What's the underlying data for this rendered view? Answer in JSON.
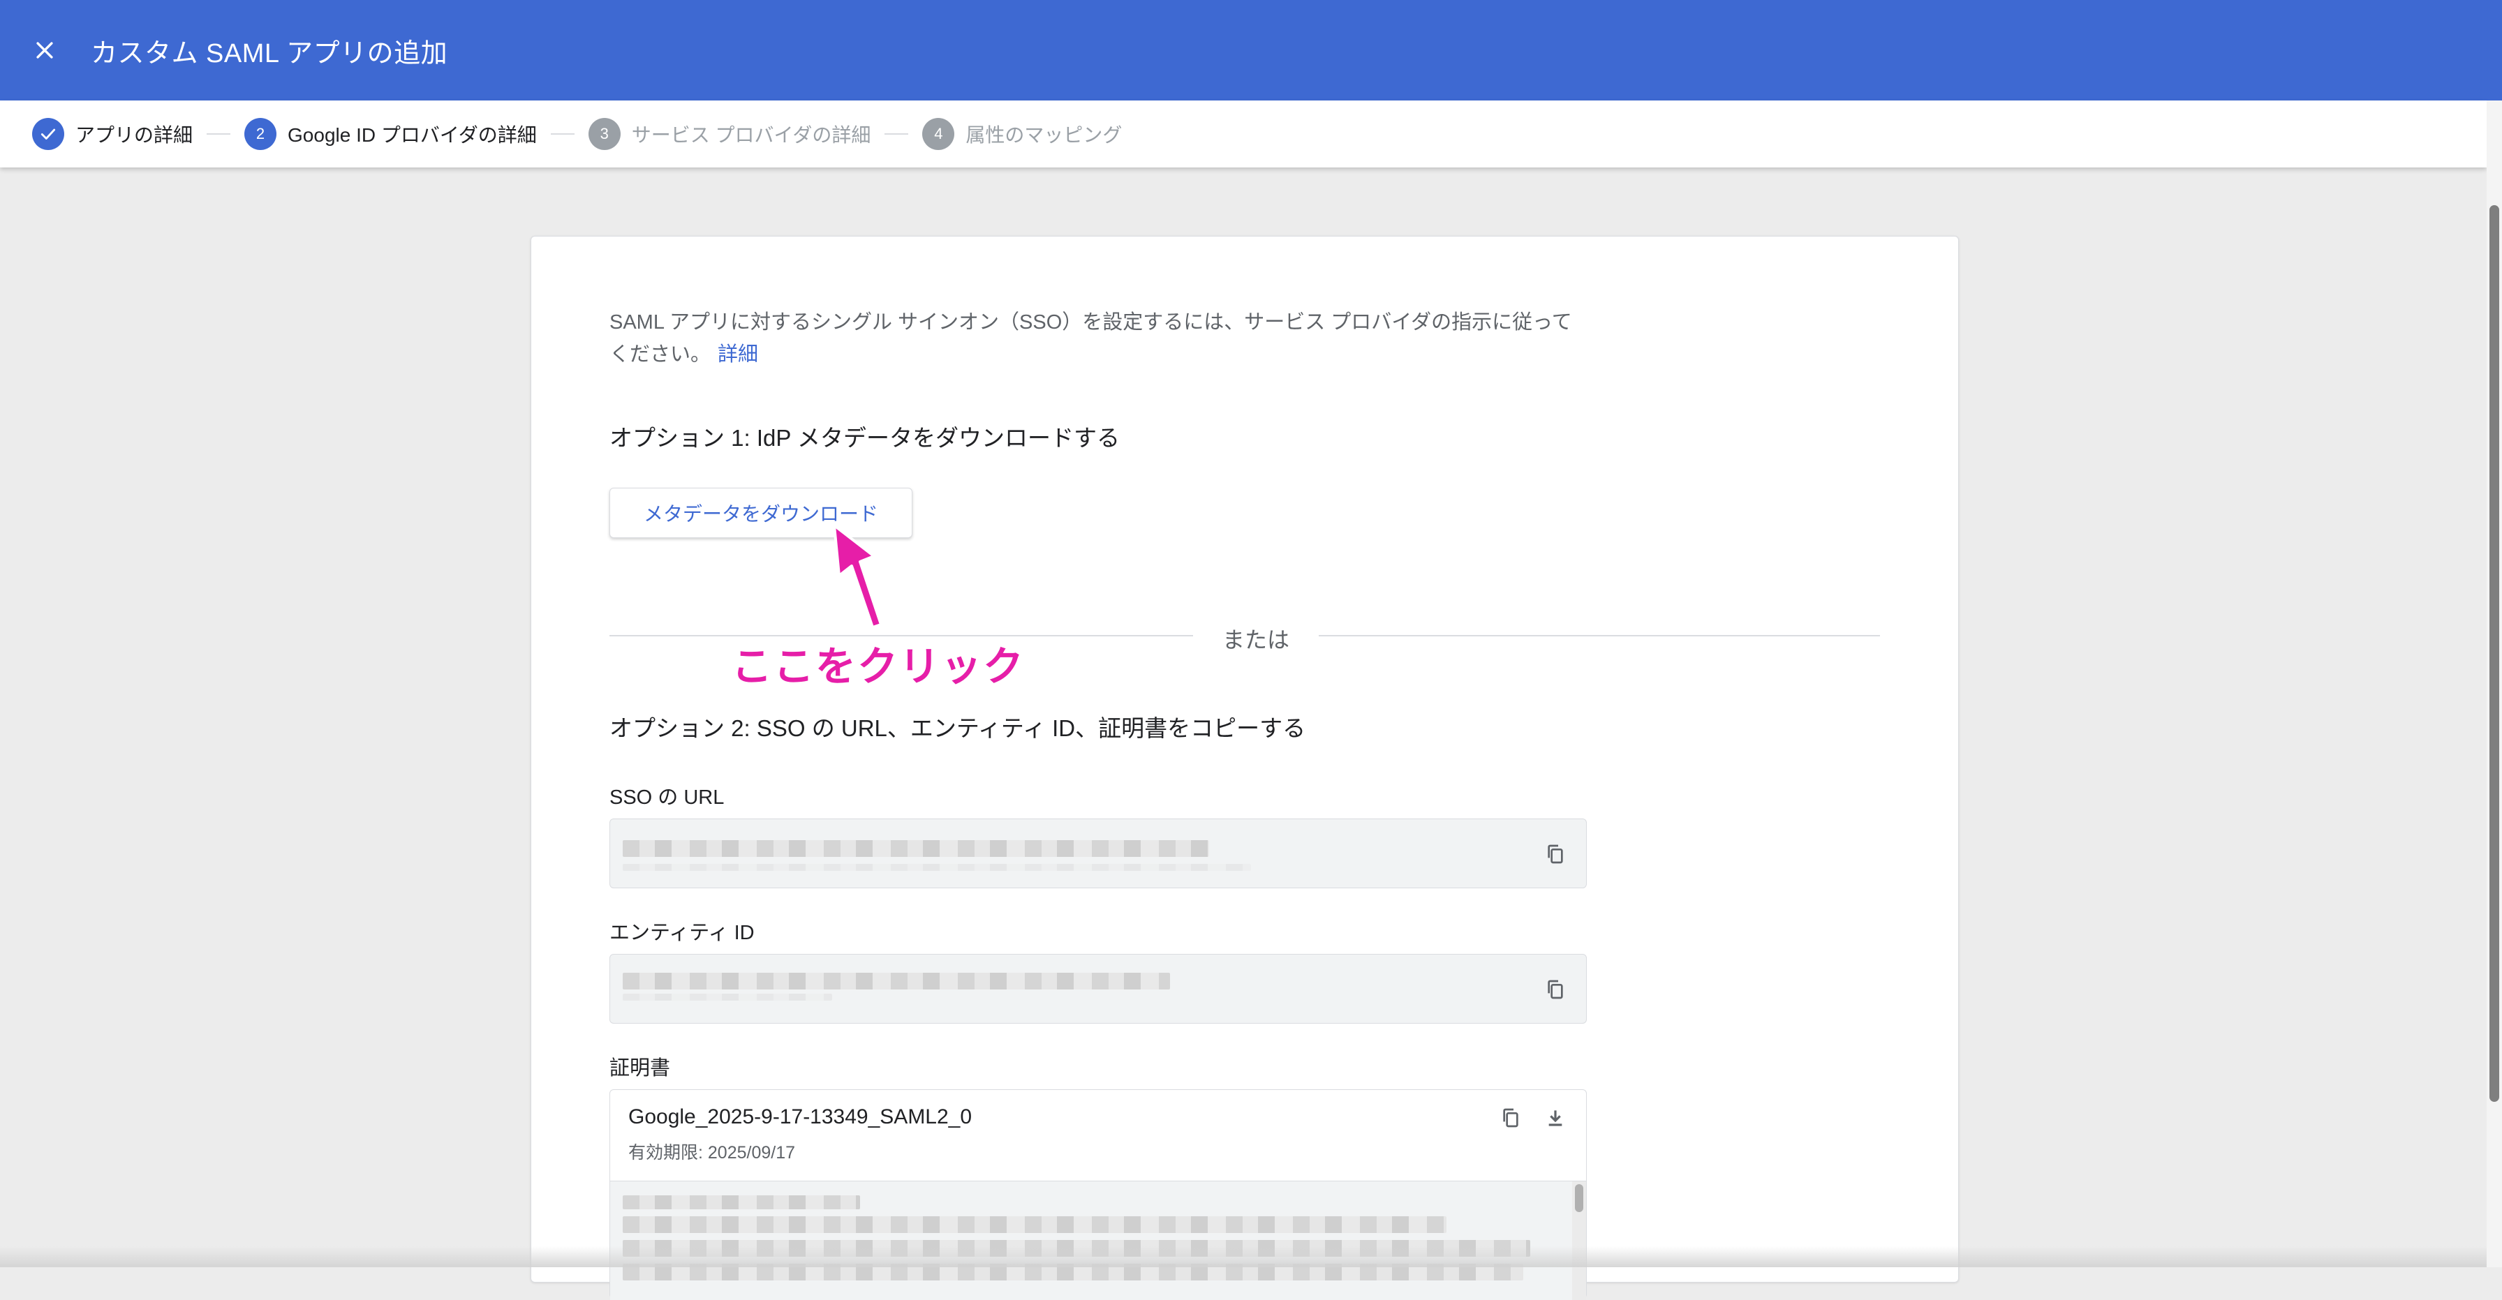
{
  "appbar": {
    "close_icon": "close-icon",
    "title": "カスタム SAML アプリの追加"
  },
  "stepper": {
    "steps": [
      {
        "number": "",
        "label": "アプリの詳細",
        "state": "done"
      },
      {
        "number": "2",
        "label": "Google ID プロバイダの詳細",
        "state": "active"
      },
      {
        "number": "3",
        "label": "サービス プロバイダの詳細",
        "state": "todo"
      },
      {
        "number": "4",
        "label": "属性のマッピング",
        "state": "todo"
      }
    ]
  },
  "card": {
    "intro_text": "SAML アプリに対するシングル サインオン（SSO）を設定するには、サービス プロバイダの指示に従ってください。",
    "intro_link": "詳細",
    "option1_heading": "オプション 1: IdP メタデータをダウンロードする",
    "download_button": "メタデータをダウンロード",
    "divider_text": "または",
    "option2_heading": "オプション 2: SSO の URL、エンティティ ID、証明書をコピーする",
    "sso_url_label": "SSO の URL",
    "entity_id_label": "エンティティ ID",
    "certificate_label": "証明書",
    "certificate": {
      "name": "Google_2025-9-17-13349_SAML2_0",
      "expiry": "有効期限: 2025/09/17"
    }
  },
  "annotation": {
    "text": "ここをクリック",
    "color": "#e61ea8"
  },
  "colors": {
    "brand": "#3e69d2",
    "background": "#ececec"
  }
}
